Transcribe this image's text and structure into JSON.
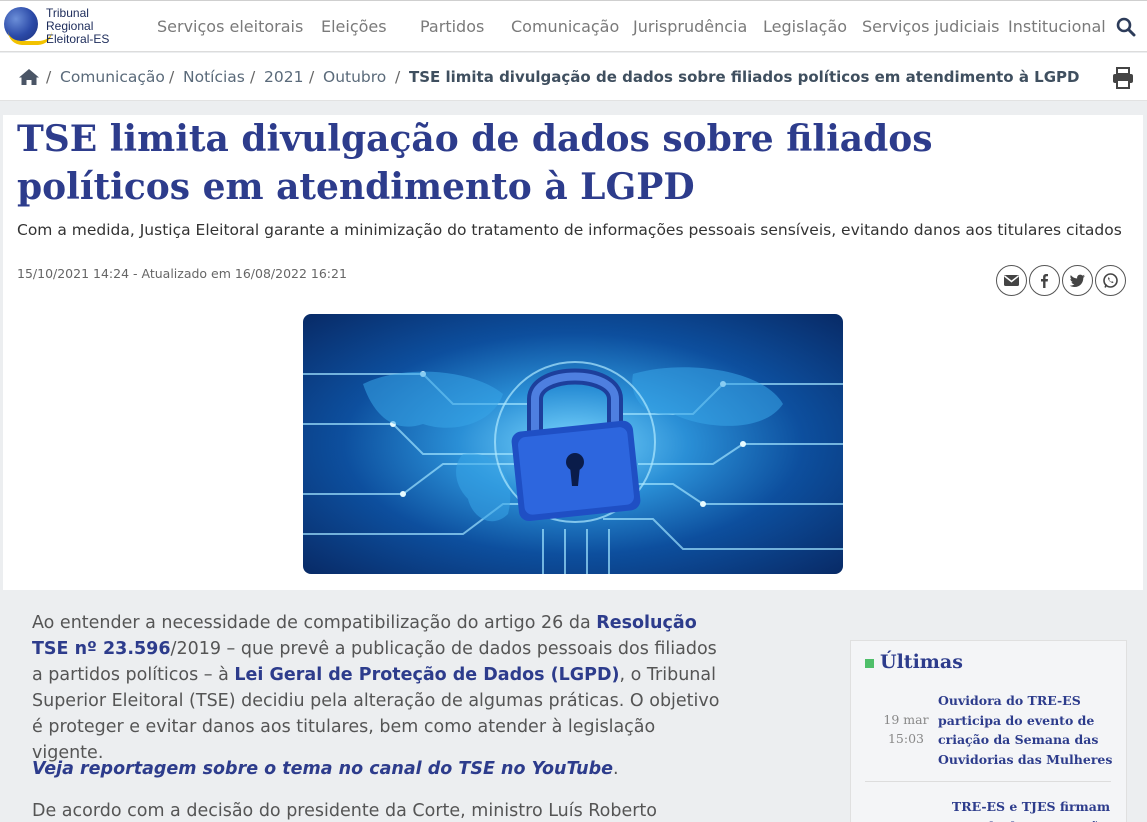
{
  "logo": {
    "line1": "Tribunal",
    "line2": "Regional",
    "line3": "Eleitoral-ES"
  },
  "nav": [
    "Serviços eleitorais",
    "Eleições",
    "Partidos",
    "Comunicação",
    "Jurisprudência",
    "Legislação",
    "Serviços judiciais",
    "Institucional"
  ],
  "breadcrumb": {
    "sep": "/",
    "items": [
      "Comunicação",
      "Notícias",
      "2021",
      "Outubro"
    ],
    "current": "TSE limita divulgação de dados sobre filiados políticos em atendimento à LGPD"
  },
  "article": {
    "title": "TSE limita divulgação de dados sobre filiados políticos em atendimento à LGPD",
    "subtitle": "Com a medida, Justiça Eleitoral garante a minimização do tratamento de informações pessoais sensíveis, evitando danos aos titulares citados",
    "date": "15/10/2021 14:24 - Atualizado em 16/08/2022 16:21",
    "p1_a": "Ao entender a necessidade de compatibilização do artigo 26 da ",
    "p1_link1": "Resolução TSE nº 23.596",
    "p1_b": "/2019 – que prevê a publicação de dados pessoais dos filiados a partidos políticos – à ",
    "p1_link2": "Lei Geral de Proteção de Dados (LGPD)",
    "p1_c": ", o Tribunal Superior Eleitoral (TSE) decidiu pela alteração de algumas práticas. O objetivo é proteger e evitar danos aos titulares, bem como atender à legislação vigente.",
    "p2_link": "Veja reportagem sobre o tema no canal do TSE no YouTube",
    "p2_end": ".",
    "p3": "De acordo com a decisão do presidente da Corte, ministro Luís Roberto Barroso, a"
  },
  "sidebar": {
    "heading": "Últimas",
    "news": [
      {
        "day": "19 mar",
        "time": "15:03",
        "title": "Ouvidora do TRE-ES participa do evento de criação da Semana das Ouvidorias das Mulheres"
      },
      {
        "day": "",
        "time": "",
        "title": "TRE-ES e TJES firmam acordo de cooperação"
      }
    ]
  },
  "colors": {
    "brand": "#2d3c8c",
    "accent": "#4fbf6a"
  }
}
